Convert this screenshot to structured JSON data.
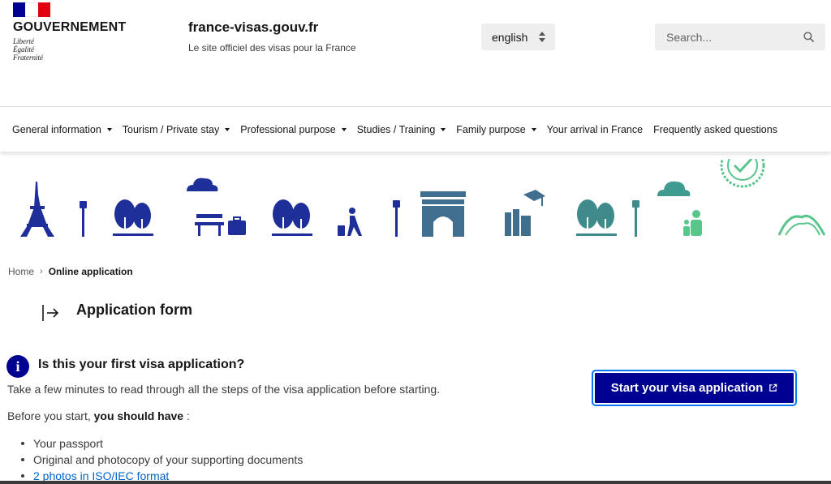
{
  "header": {
    "gov_name": "GOUVERNEMENT",
    "motto": [
      "Liberté",
      "Égalité",
      "Fraternité"
    ],
    "site_name": "france-visas.gouv.fr",
    "tagline": "Le site officiel des visas pour la France",
    "language_selected": "english",
    "search_placeholder": "Search..."
  },
  "nav": {
    "items": [
      {
        "label": "General information"
      },
      {
        "label": "Tourism / Private stay"
      },
      {
        "label": "Professional purpose"
      },
      {
        "label": "Studies / Training"
      },
      {
        "label": "Family purpose"
      },
      {
        "label": "Your arrival in France"
      },
      {
        "label": "Frequently asked questions"
      }
    ]
  },
  "breadcrumb": {
    "home": "Home",
    "current": "Online application"
  },
  "page": {
    "title": "Application form",
    "info_title": "Is this your first visa application?",
    "intro": "Take a few minutes to read through all the steps of the visa application before starting.",
    "before_prefix": "Before you start, ",
    "before_bold": "you should have",
    "before_suffix": " :",
    "requirements": [
      "Your passport",
      "Original and photocopy of your supporting documents",
      "2 photos in ISO/IEC format"
    ],
    "cta_label": "Start your visa application"
  },
  "colors": {
    "primary": "#000091",
    "flag_blue": "#000091",
    "flag_red": "#e1000f",
    "illus_navy": "#1f2f99",
    "illus_teal": "#3f8a8a",
    "illus_green": "#58c58b",
    "link": "#0063cb"
  },
  "icons": [
    "selector-arrows-icon",
    "search-icon",
    "external-link-icon",
    "info-icon",
    "arrow-right-bar-icon"
  ]
}
